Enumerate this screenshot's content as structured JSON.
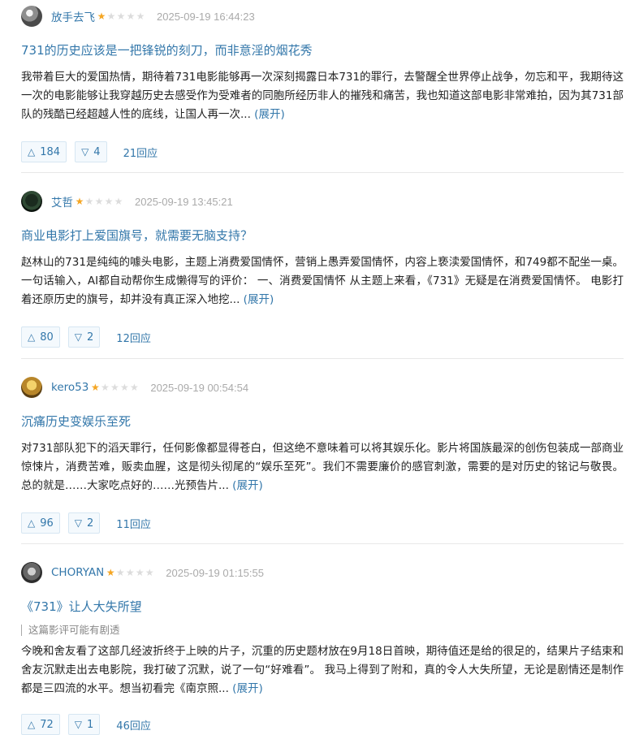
{
  "reviews": [
    {
      "author": "放手去飞",
      "rating_stars": 1,
      "time": "2025-09-19 16:44:23",
      "title": "731的历史应该是一把锋锐的刻刀，而非意淫的烟花秀",
      "spoiler_note": "",
      "body": "我带着巨大的爱国热情，期待着731电影能够再一次深刻揭露日本731的罪行，去警醒全世界停止战争，勿忘和平，我期待这一次的电影能够让我穿越历史去感受作为受难者的同胞所经历非人的摧残和痛苦，我也知道这部电影非常难拍，因为其731部队的残酷已经超越人性的底线，让国人再一次...",
      "expand_label": "(展开)",
      "up": "184",
      "down": "4",
      "replies": "21回应"
    },
    {
      "author": "艾哲",
      "rating_stars": 1,
      "time": "2025-09-19 13:45:21",
      "title": "商业电影打上爱国旗号，就需要无脑支持？",
      "spoiler_note": "",
      "body": "赵林山的731是纯纯的噱头电影，主题上消费爱国情怀，营销上愚弄爱国情怀，内容上亵渎爱国情怀，和749都不配坐一桌。 一句话输入，AI都自动帮你生成懒得写的评价： 一、消费爱国情怀 从主题上来看，《731》无疑是在消费爱国情怀。 电影打着还原历史的旗号，却并没有真正深入地挖...",
      "expand_label": "(展开)",
      "up": "80",
      "down": "2",
      "replies": "12回应"
    },
    {
      "author": "kero53",
      "rating_stars": 1,
      "time": "2025-09-19 00:54:54",
      "title": "沉痛历史变娱乐至死",
      "spoiler_note": "",
      "body": "对731部队犯下的滔天罪行，任何影像都显得苍白，但这绝不意味着可以将其娱乐化。影片将国族最深的创伤包装成一部商业惊悚片，消费苦难，贩卖血腥，这是彻头彻尾的“娱乐至死”。我们不需要廉价的感官刺激，需要的是对历史的铭记与敬畏。 总的就是……大家吃点好的……光预告片...",
      "expand_label": "(展开)",
      "up": "96",
      "down": "2",
      "replies": "11回应"
    },
    {
      "author": "CHORYAN",
      "rating_stars": 1,
      "time": "2025-09-19 01:15:55",
      "title": "《731》让人大失所望",
      "spoiler_note": "这篇影评可能有剧透",
      "body": "今晚和舍友看了这部几经波折终于上映的片子，沉重的历史题材放在9月18日首映，期待值还是给的很足的，结果片子结束和舍友沉默走出去电影院，我打破了沉默，说了一句“好难看”。 我马上得到了附和，真的令人大失所望，无论是剧情还是制作都是三四流的水平。想当初看完《南京照...",
      "expand_label": "(展开)",
      "up": "72",
      "down": "1",
      "replies": "46回应"
    }
  ],
  "icons": {
    "up": "triangle-up-icon",
    "down": "triangle-down-icon",
    "star": "star-icon"
  },
  "colors": {
    "link": "#3377aa",
    "star_on": "#f5a623",
    "star_off": "#dcdcdc",
    "meta": "#aaaaaa"
  }
}
